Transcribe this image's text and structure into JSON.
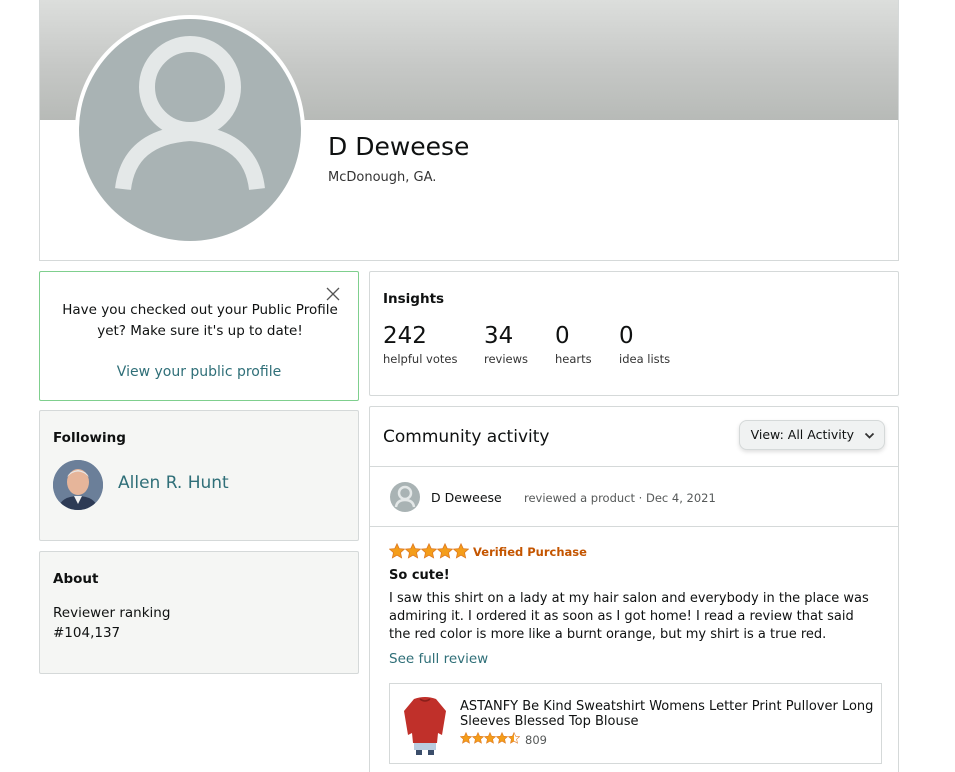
{
  "profile": {
    "name": "D Deweese",
    "location": "McDonough, GA."
  },
  "tip": {
    "text": "Have you checked out your Public Profile yet? Make sure it's up to date!",
    "link": "View your public profile"
  },
  "following": {
    "title": "Following",
    "people": [
      {
        "name": "Allen R. Hunt"
      }
    ]
  },
  "about": {
    "title": "About",
    "ranking_label": "Reviewer ranking",
    "ranking_value": "#104,137"
  },
  "insights": {
    "title": "Insights",
    "stats": [
      {
        "value": "242",
        "label": "helpful votes"
      },
      {
        "value": "34",
        "label": "reviews"
      },
      {
        "value": "0",
        "label": "hearts"
      },
      {
        "value": "0",
        "label": "idea lists"
      }
    ]
  },
  "activity": {
    "title": "Community activity",
    "view_label": "View:",
    "view_value": "All Activity",
    "post": {
      "author": "D Deweese",
      "meta": "reviewed a product · Dec 4, 2021",
      "rating": 5,
      "verified": "Verified Purchase",
      "title": "So cute!",
      "body": "I saw this shirt on a lady at my hair salon and everybody in the place was admiring it. I ordered it as soon as I got home! I read a review that said the red color is more like a burnt orange, but my shirt is a true red.",
      "see_full": "See full review",
      "product": {
        "title": "ASTANFY Be Kind Sweatshirt Womens Letter Print Pullover Long Sleeves Blessed Top Blouse",
        "rating": 4.5,
        "rating_count": "809"
      }
    }
  },
  "colors": {
    "link": "#2f6f78",
    "star": "#f49d1a",
    "verified": "#c45500",
    "tip_border": "#7fcf8e",
    "avatar_bg": "#a9b3b4"
  }
}
